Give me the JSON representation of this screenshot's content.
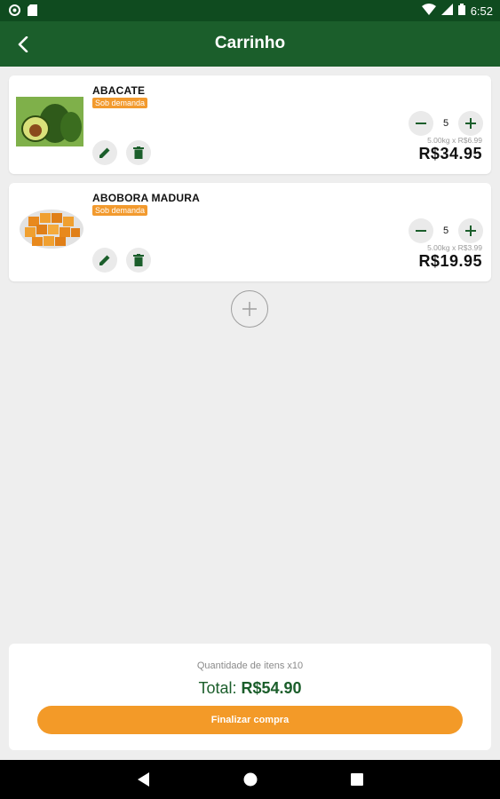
{
  "status_bar": {
    "time": "6:52"
  },
  "app_bar": {
    "title": "Carrinho"
  },
  "cart": [
    {
      "name": "ABACATE",
      "badge": "Sob demanda",
      "quantity": "5",
      "unit_detail": "5.00kg x R$6.99",
      "price": "R$34.95"
    },
    {
      "name": "ABOBORA MADURA",
      "badge": "Sob demanda",
      "quantity": "5",
      "unit_detail": "5.00kg x R$3.99",
      "price": "R$19.95"
    }
  ],
  "summary": {
    "items_count": "Quantidade de itens x10",
    "total_label": "Total:",
    "total_value": "R$54.90",
    "checkout_label": "Finalizar compra"
  },
  "colors": {
    "primary": "#1b5e2b",
    "status_bar": "#0f4b1f",
    "accent": "#f39a28",
    "background": "#eeeeee"
  }
}
